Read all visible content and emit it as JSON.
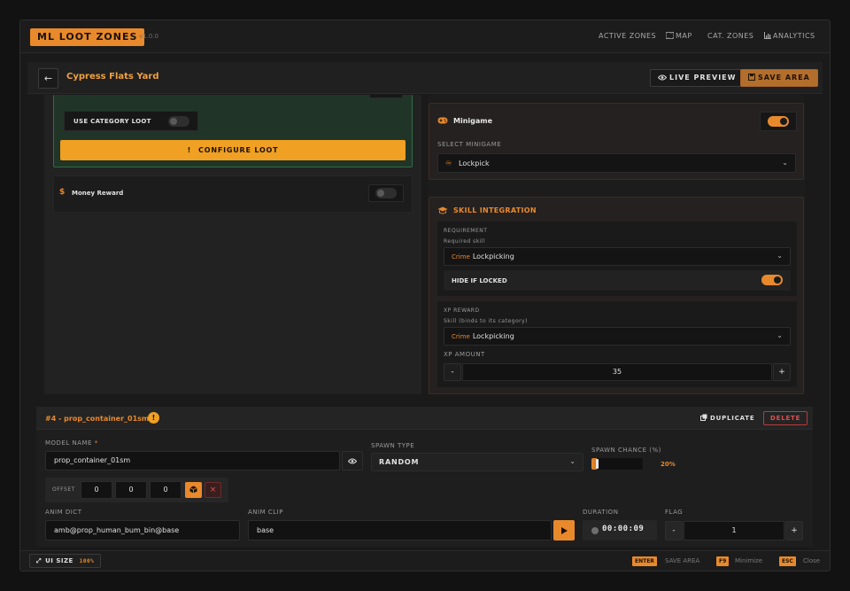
{
  "app": {
    "title": "ML LOOT ZONES",
    "version": "v1.0.0"
  },
  "nav": [
    {
      "label": "ACTIVE ZONES",
      "icon": "zones-icon"
    },
    {
      "label": "MAP",
      "icon": "map-icon"
    },
    {
      "label": "CAT. ZONES",
      "icon": "category-icon"
    },
    {
      "label": "ANALYTICS",
      "icon": "analytics-icon"
    }
  ],
  "header": {
    "title": "Cypress Flats Yard",
    "live_preview": "LIVE PREVIEW",
    "save_area": "SAVE AREA"
  },
  "loot": {
    "use_category_label": "USE CATEGORY LOOT",
    "configure_label": "CONFIGURE LOOT",
    "configure_icon": "!",
    "money_reward_label": "Money Reward",
    "money_icon": "$"
  },
  "minigame": {
    "title": "Minigame",
    "select_label": "SELECT MINIGAME",
    "selected": "Lockpick"
  },
  "skill": {
    "title": "SKILL INTEGRATION",
    "requirement_label": "REQUIREMENT",
    "required_skill_label": "Required skill",
    "req_category": "Crime",
    "req_skill": "Lockpicking",
    "hide_if_locked_label": "HIDE IF LOCKED",
    "xp_reward_label": "XP REWARD",
    "xp_skill_label": "Skill (binds to its category)",
    "xp_category": "Crime",
    "xp_skill": "Lockpicking",
    "xp_amount_label": "XP AMOUNT",
    "xp_amount": "35",
    "minus": "-",
    "plus": "+"
  },
  "prop": {
    "heading": "#4 - prop_container_01sm",
    "warn": "!",
    "duplicate": "DUPLICATE",
    "delete": "DELETE",
    "model_name_label": "MODEL NAME",
    "required_mark": "*",
    "model_name": "prop_container_01sm",
    "spawn_type_label": "SPAWN TYPE",
    "spawn_type": "RANDOM",
    "spawn_chance_label": "SPAWN CHANCE (%)",
    "spawn_chance_text": "20%",
    "spawn_chance": 0.2,
    "offset_label": "OFFSET",
    "offset_x": "0",
    "offset_y": "0",
    "offset_z": "0",
    "clear": "×",
    "anim_dict_label": "ANIM DICT",
    "anim_dict": "amb@prop_human_bum_bin@base",
    "anim_clip_label": "ANIM CLIP",
    "anim_clip": "base",
    "duration_label": "DURATION",
    "duration": "00:00:09",
    "flag_label": "FLAG",
    "flag": "1",
    "minus": "-",
    "plus": "+"
  },
  "footer": {
    "ui_size_label": "UI SIZE",
    "ui_size_value": "100%",
    "shortcuts": [
      {
        "key": "ENTER",
        "label": "SAVE AREA"
      },
      {
        "key": "F9",
        "label": "Minimize"
      },
      {
        "key": "ESC",
        "label": "Close"
      }
    ]
  },
  "colors": {
    "accent": "#e8892c",
    "danger": "#d94545",
    "bg": "#1a1a1a"
  }
}
